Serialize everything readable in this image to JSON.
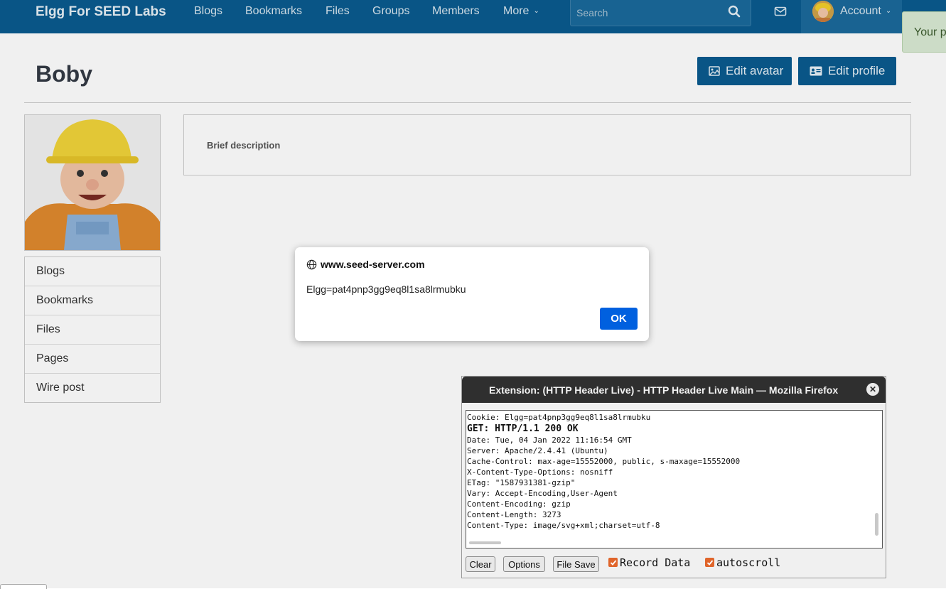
{
  "nav": {
    "brand": "Elgg For SEED Labs",
    "links": [
      "Blogs",
      "Bookmarks",
      "Files",
      "Groups",
      "Members",
      "More"
    ],
    "search_placeholder": "Search",
    "account_label": "Account"
  },
  "toast": {
    "text": "Your p"
  },
  "profile": {
    "name": "Boby",
    "edit_avatar": "Edit avatar",
    "edit_profile": "Edit profile",
    "brief_description_label": "Brief description",
    "menu": [
      "Blogs",
      "Bookmarks",
      "Files",
      "Pages",
      "Wire post"
    ]
  },
  "dialog": {
    "origin": "www.seed-server.com",
    "message": "Elgg=pat4pnp3gg9eq8l1sa8lrmubku",
    "ok": "OK"
  },
  "extension": {
    "title": "Extension: (HTTP Header Live) - HTTP Header Live Main — Mozilla Firefox",
    "log": [
      {
        "text": "Cookie: Elgg=pat4pnp3gg9eq8l1sa8lrmubku",
        "bold": false
      },
      {
        "text": "GET: HTTP/1.1 200 OK",
        "bold": true
      },
      {
        "text": "Date: Tue, 04 Jan 2022 11:16:54 GMT",
        "bold": false
      },
      {
        "text": "Server: Apache/2.4.41 (Ubuntu)",
        "bold": false
      },
      {
        "text": "Cache-Control: max-age=15552000, public, s-maxage=15552000",
        "bold": false
      },
      {
        "text": "X-Content-Type-Options: nosniff",
        "bold": false
      },
      {
        "text": "ETag: \"1587931381-gzip\"",
        "bold": false
      },
      {
        "text": "Vary: Accept-Encoding,User-Agent",
        "bold": false
      },
      {
        "text": "Content-Encoding: gzip",
        "bold": false
      },
      {
        "text": "Content-Length: 3273",
        "bold": false
      },
      {
        "text": "Content-Type: image/svg+xml;charset=utf-8",
        "bold": false
      }
    ],
    "buttons": {
      "clear": "Clear",
      "options": "Options",
      "file_save": "File Save"
    },
    "record_data_label": "Record Data",
    "record_data_checked": true,
    "autoscroll_label": "autoscroll",
    "autoscroll_checked": true
  }
}
